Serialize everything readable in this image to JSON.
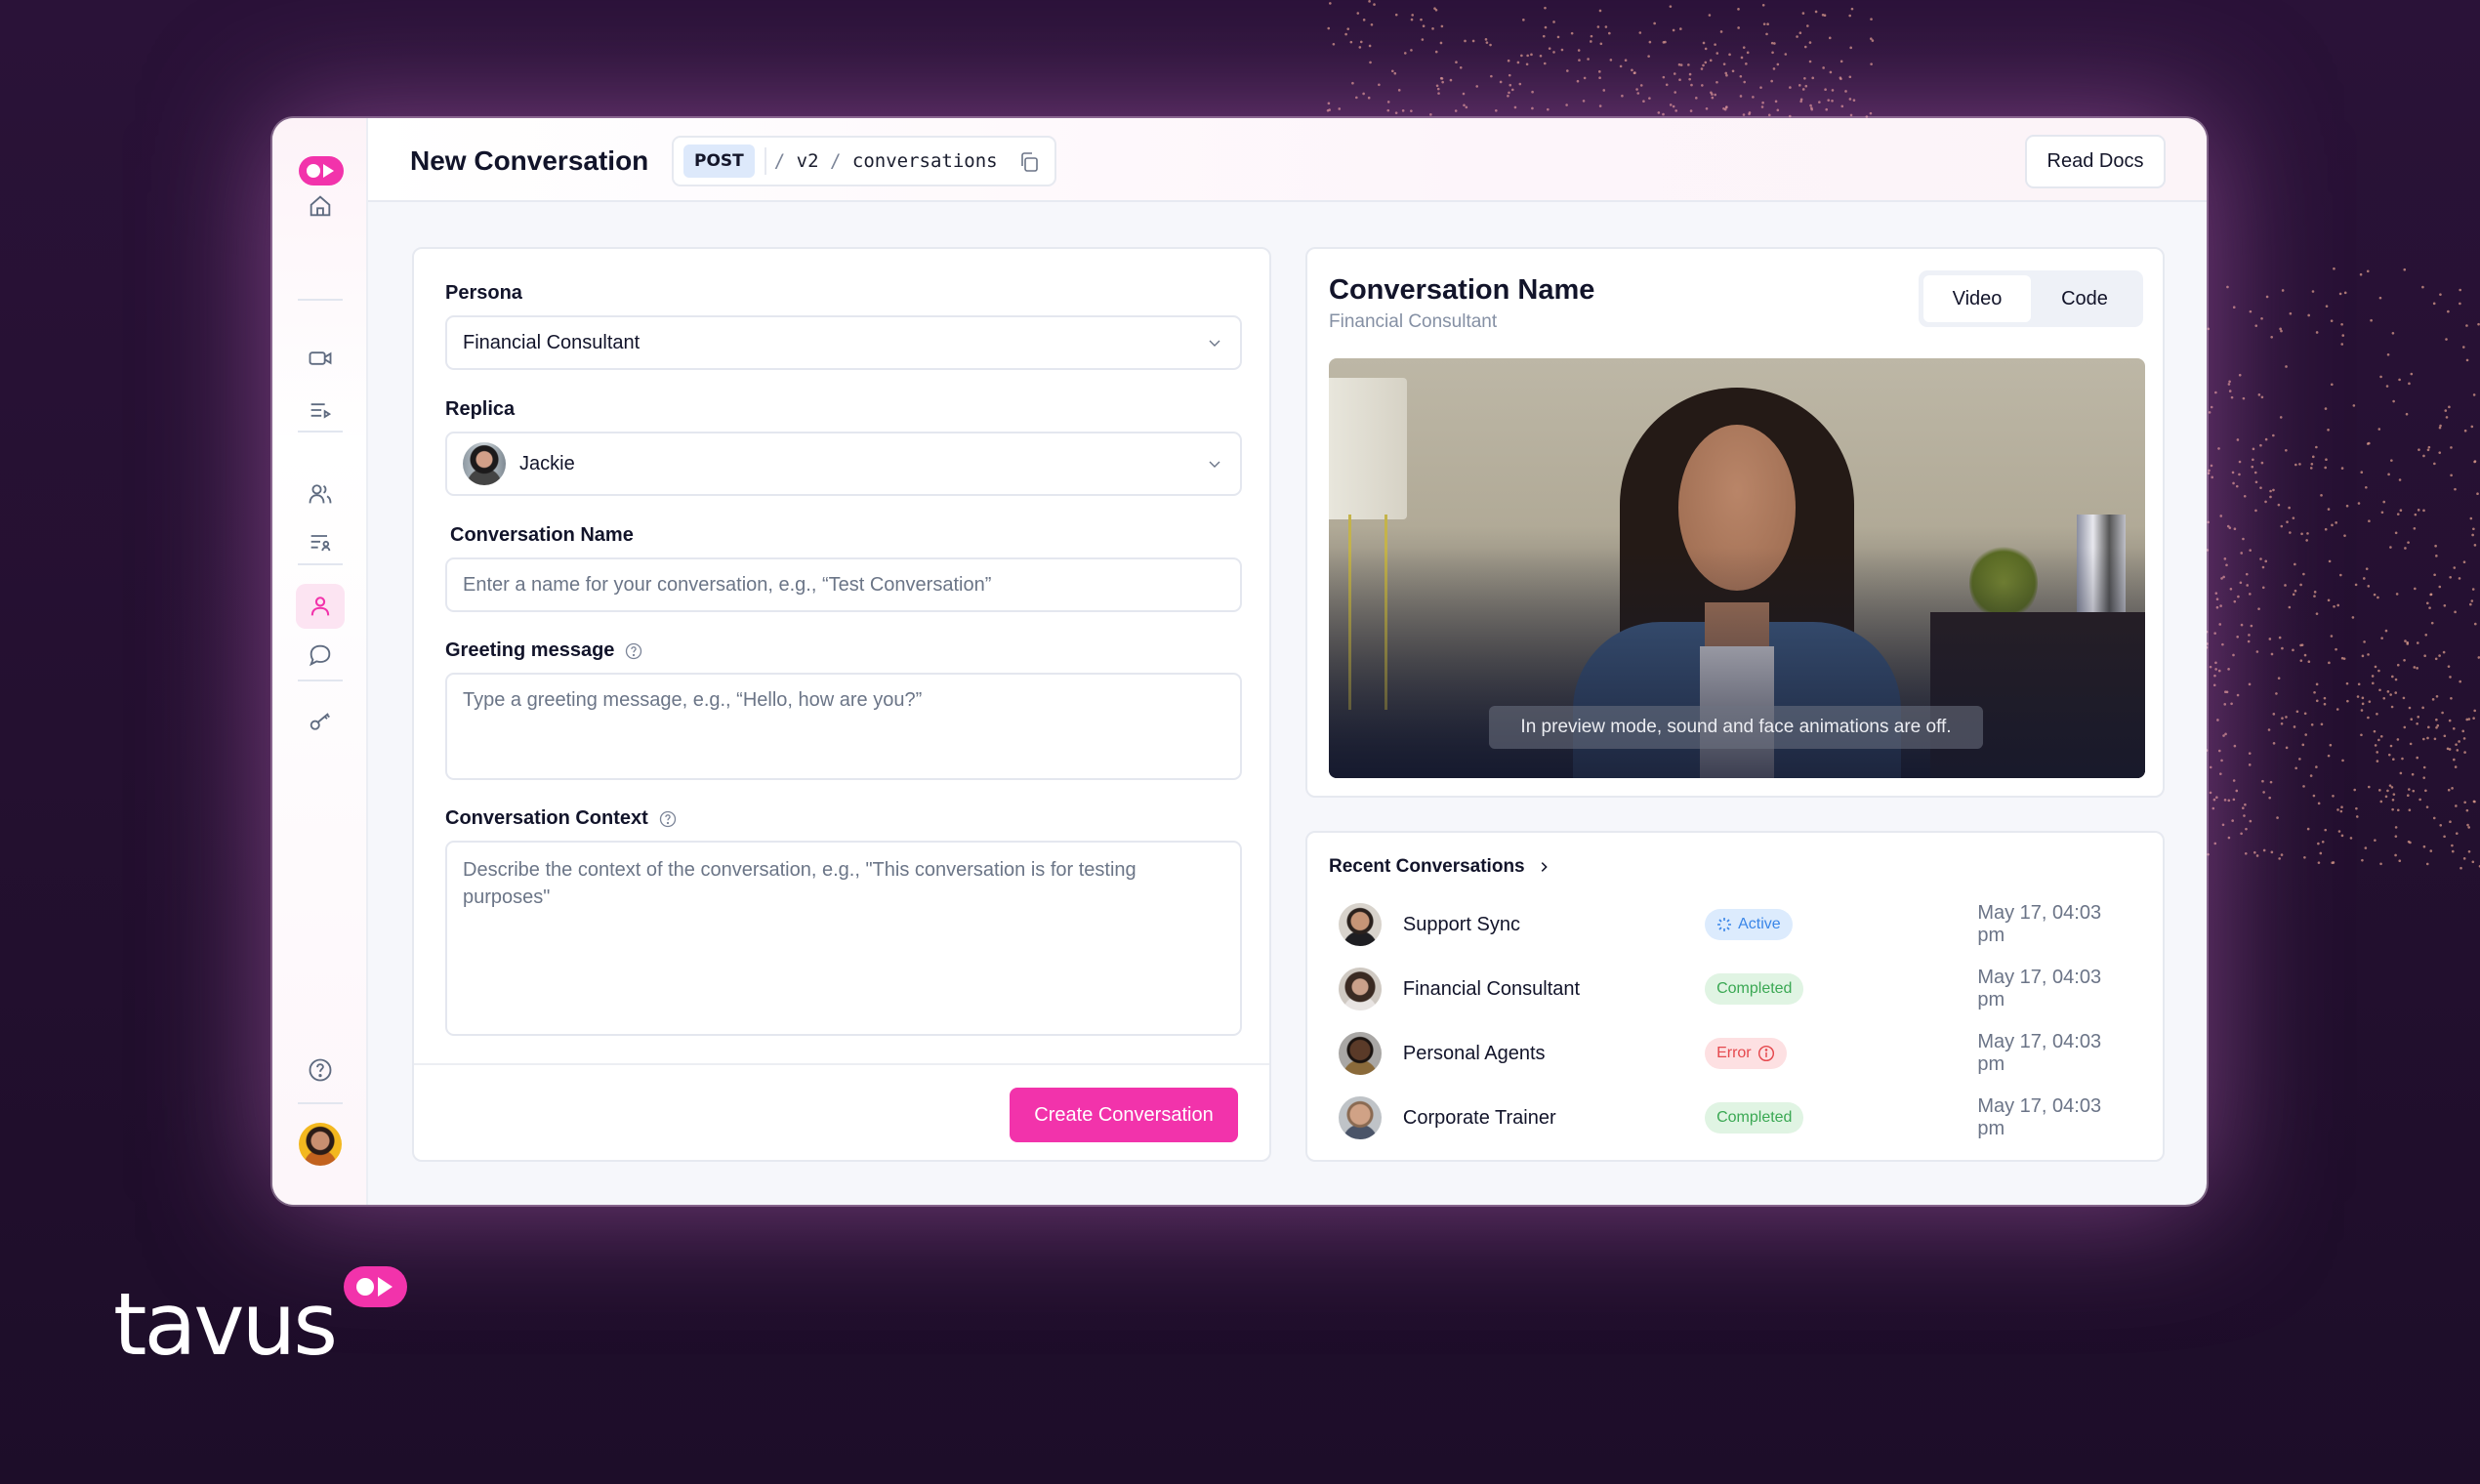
{
  "app": {
    "brand_name": "tavus",
    "brand_color": "#f233ab"
  },
  "sidebar": {
    "items": [
      {
        "name": "home",
        "icon": "home-icon",
        "active": false
      },
      {
        "name": "video",
        "icon": "video-camera-icon",
        "active": false
      },
      {
        "name": "playlist",
        "icon": "playlist-play-icon",
        "active": false
      },
      {
        "name": "users",
        "icon": "users-icon",
        "active": false
      },
      {
        "name": "user-list",
        "icon": "user-list-icon",
        "active": false
      },
      {
        "name": "persona",
        "icon": "user-icon",
        "active": true
      },
      {
        "name": "conversations",
        "icon": "chat-bubble-icon",
        "active": false
      },
      {
        "name": "api-keys",
        "icon": "key-icon",
        "active": false
      },
      {
        "name": "help",
        "icon": "help-circle-icon",
        "active": false
      }
    ]
  },
  "header": {
    "title": "New Conversation",
    "endpoint": {
      "method": "POST",
      "path_parts": [
        "v2",
        "conversations"
      ],
      "copy_icon": "copy-icon"
    },
    "read_docs_label": "Read Docs"
  },
  "form": {
    "persona": {
      "label": "Persona",
      "value": "Financial Consultant"
    },
    "replica": {
      "label": "Replica",
      "value": "Jackie"
    },
    "conversation_name": {
      "label": "Conversation Name",
      "value": "",
      "placeholder": "Enter a name for your conversation, e.g., “Test Conversation”"
    },
    "greeting": {
      "label": "Greeting message",
      "value": "",
      "placeholder": "Type a greeting message, e.g., “Hello, how are you?”"
    },
    "context": {
      "label": "Conversation Context",
      "value": "",
      "placeholder": "Describe the context of the conversation, e.g., \"This conversation is for testing purposes\""
    },
    "submit_label": "Create Conversation"
  },
  "preview": {
    "title": "Conversation Name",
    "subtitle": "Financial Consultant",
    "tabs": [
      {
        "label": "Video",
        "active": true
      },
      {
        "label": "Code",
        "active": false
      }
    ],
    "caption": "In preview mode, sound and face animations are off."
  },
  "recent": {
    "title": "Recent Conversations",
    "rows": [
      {
        "name": "Support Sync",
        "status": "Active",
        "status_type": "active",
        "date": "May 17, 04:03 pm"
      },
      {
        "name": "Financial Consultant",
        "status": "Completed",
        "status_type": "completed",
        "date": "May 17, 04:03 pm"
      },
      {
        "name": "Personal Agents",
        "status": "Error",
        "status_type": "error",
        "date": "May 17, 04:03 pm"
      },
      {
        "name": "Corporate Trainer",
        "status": "Completed",
        "status_type": "completed",
        "date": "May 17, 04:03 pm"
      }
    ]
  }
}
